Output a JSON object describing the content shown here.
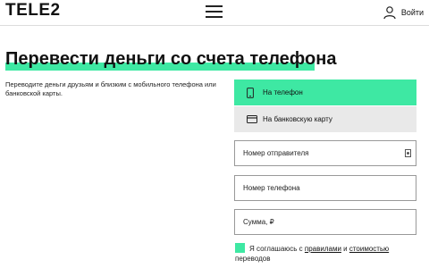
{
  "header": {
    "logo": "TELE2",
    "menu_icon": "hamburger-menu-icon",
    "login_icon": "user-icon",
    "login_label": "Войти"
  },
  "page": {
    "title": "Перевести деньги со счета телефона",
    "description": "Переводите деньги друзьям и близким с мобильного телефона или банковской карты."
  },
  "form": {
    "tabs": [
      {
        "label": "На телефон",
        "icon": "phone-icon",
        "active": true
      },
      {
        "label": "На банковскую карту",
        "icon": "bank-card-icon",
        "active": false
      }
    ],
    "sender_placeholder": "Номер отправителя",
    "phone_placeholder": "Номер телефона",
    "amount_placeholder": "Сумма, ₽",
    "agree": {
      "prefix": "Я соглашаюсь с ",
      "rules_link": "правилами",
      "middle": " и ",
      "cost_link": "стоимостью",
      "suffix": "переводов"
    }
  },
  "colors": {
    "accent": "#3ee8a3",
    "card_tab_bg": "#e9e9e9"
  }
}
